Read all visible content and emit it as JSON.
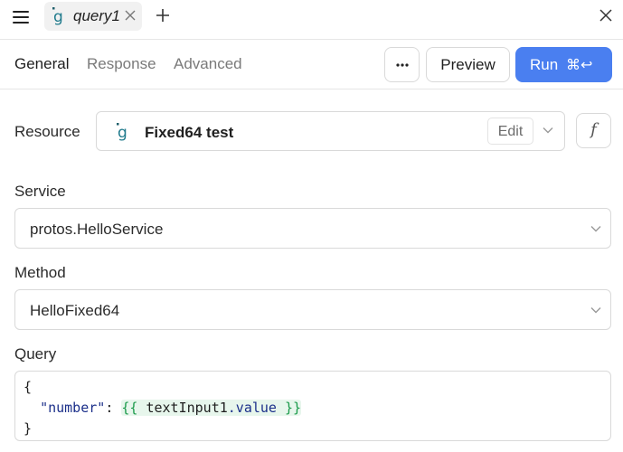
{
  "tab": {
    "label": "query1"
  },
  "nav": {
    "tabs": [
      {
        "label": "General"
      },
      {
        "label": "Response"
      },
      {
        "label": "Advanced"
      }
    ],
    "more_label": "···",
    "preview_label": "Preview",
    "run_label": "Run",
    "run_shortcut": "⌘↩"
  },
  "resource": {
    "label": "Resource",
    "name": "Fixed64 test",
    "edit_label": "Edit",
    "fx_label": "f"
  },
  "service": {
    "label": "Service",
    "value": "protos.HelloService"
  },
  "method": {
    "label": "Method",
    "value": "HelloFixed64"
  },
  "query": {
    "label": "Query",
    "line1": "{",
    "key": "\"number\"",
    "colon": ": ",
    "tpl_open": "{{ ",
    "ident": "textInput1",
    "prop": ".value",
    "tpl_close": " }}",
    "line3": "}"
  },
  "colors": {
    "accent": "#4a7ff0",
    "border": "#d9d9d9",
    "template_bg": "#e7f6ec",
    "template_fg": "#1a9a4a"
  },
  "icons": [
    "hamburger-menu-icon",
    "grpc-logo-icon",
    "close-icon",
    "plus-icon",
    "more-icon",
    "chevron-down-icon",
    "function-icon"
  ]
}
